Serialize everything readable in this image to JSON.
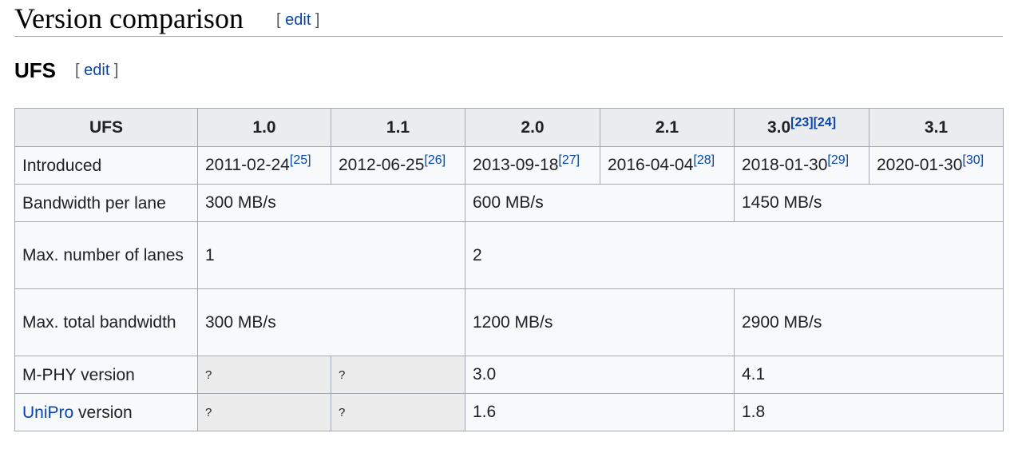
{
  "section": {
    "title": "Version comparison",
    "edit_open": "[ ",
    "edit_label": "edit",
    "edit_close": " ]"
  },
  "subsection": {
    "title": "UFS",
    "edit_open": "[ ",
    "edit_label": "edit",
    "edit_close": " ]"
  },
  "table": {
    "header": {
      "corner": "UFS",
      "versions": [
        "1.0",
        "1.1",
        "2.0",
        "2.1",
        "3.0",
        "3.1"
      ],
      "v30_refs": [
        "[23]",
        "[24]"
      ]
    },
    "introduced": {
      "label": "Introduced",
      "dates": [
        "2011-02-24",
        "2012-06-25",
        "2013-09-18",
        "2016-04-04",
        "2018-01-30",
        "2020-01-30"
      ],
      "refs": [
        "[25]",
        "[26]",
        "[27]",
        "[28]",
        "[29]",
        "[30]"
      ]
    },
    "bandwidth_per_lane": {
      "label": "Bandwidth per lane",
      "values": [
        "300 MB/s",
        "600 MB/s",
        "1450 MB/s"
      ]
    },
    "max_lanes": {
      "label": "Max. number of lanes",
      "values": [
        "1",
        "2"
      ]
    },
    "max_total_bandwidth": {
      "label": "Max. total bandwidth",
      "values": [
        "300 MB/s",
        "1200 MB/s",
        "2900 MB/s"
      ]
    },
    "mphy": {
      "label": "M-PHY version",
      "unknown": [
        "?",
        "?"
      ],
      "values": [
        "3.0",
        "4.1"
      ]
    },
    "unipro": {
      "label_link": "UniPro",
      "label_rest": " version",
      "unknown": [
        "?",
        "?"
      ],
      "values": [
        "1.6",
        "1.8"
      ]
    }
  }
}
